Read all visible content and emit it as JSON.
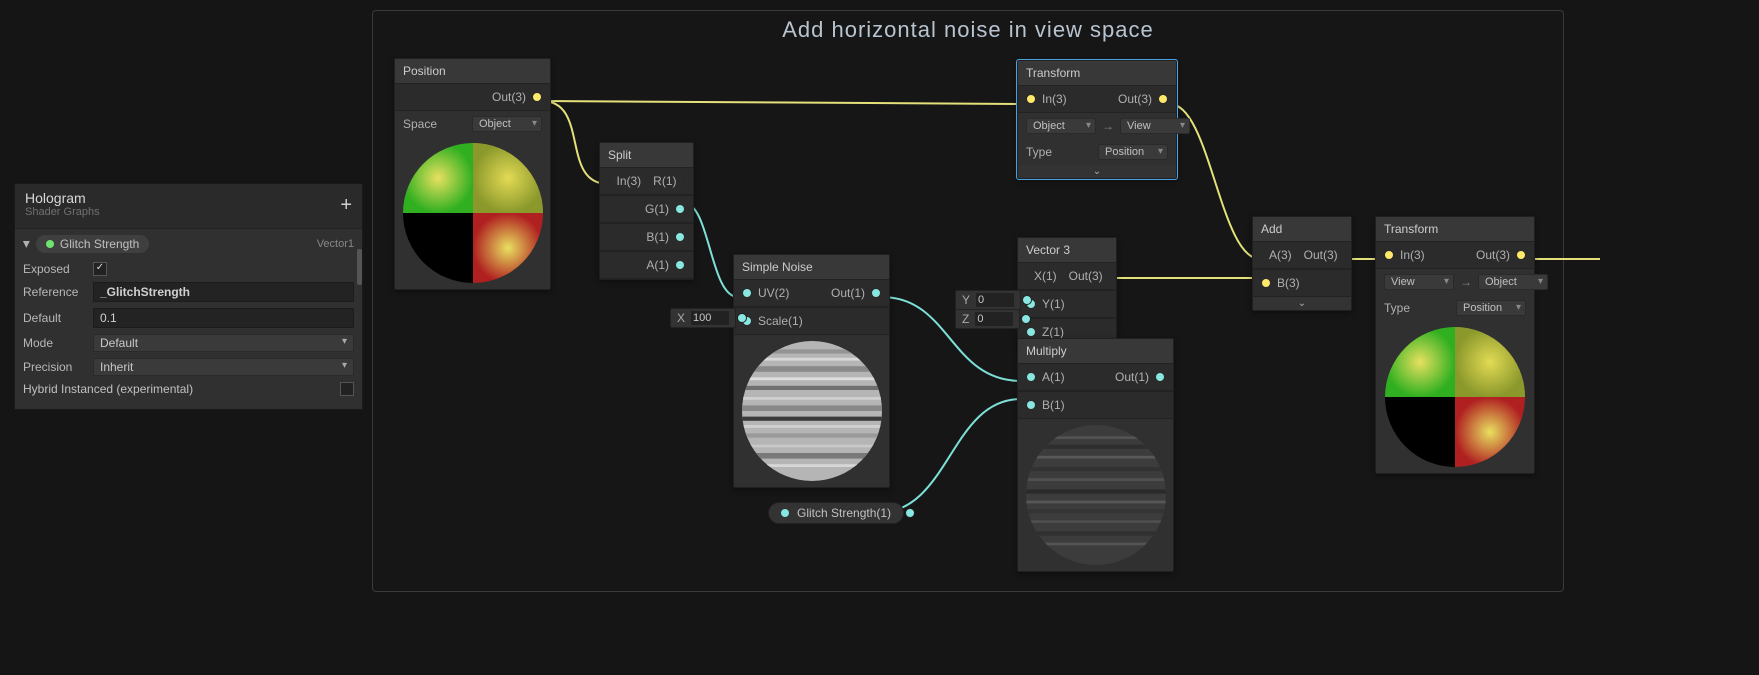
{
  "group_title": "Add horizontal noise in view space",
  "inspector": {
    "title": "Hologram",
    "subtitle": "Shader Graphs",
    "param_name": "Glitch Strength",
    "param_type": "Vector1",
    "exposed_label": "Exposed",
    "exposed_check": "✓",
    "reference_label": "Reference",
    "reference_value": "_GlitchStrength",
    "default_label": "Default",
    "default_value": "0.1",
    "mode_label": "Mode",
    "mode_value": "Default",
    "precision_label": "Precision",
    "precision_value": "Inherit",
    "hybrid_label": "Hybrid Instanced (experimental)"
  },
  "nodes": {
    "position": {
      "title": "Position",
      "out": "Out(3)",
      "space_label": "Space",
      "space_value": "Object"
    },
    "split": {
      "title": "Split",
      "in": "In(3)",
      "r": "R(1)",
      "g": "G(1)",
      "b": "B(1)",
      "a": "A(1)"
    },
    "simple_noise": {
      "title": "Simple Noise",
      "uv": "UV(2)",
      "scale": "Scale(1)",
      "out": "Out(1)",
      "x_label": "X",
      "x_value": "100"
    },
    "transform1": {
      "title": "Transform",
      "in": "In(3)",
      "out": "Out(3)",
      "from": "Object",
      "to": "View",
      "type_label": "Type",
      "type_value": "Position"
    },
    "vector3": {
      "title": "Vector 3",
      "x": "X(1)",
      "y": "Y(1)",
      "z": "Z(1)",
      "out": "Out(3)",
      "y_label": "Y",
      "y_value": "0",
      "z_label": "Z",
      "z_value": "0"
    },
    "multiply": {
      "title": "Multiply",
      "a": "A(1)",
      "b": "B(1)",
      "out": "Out(1)"
    },
    "add": {
      "title": "Add",
      "a": "A(3)",
      "b": "B(3)",
      "out": "Out(3)"
    },
    "transform2": {
      "title": "Transform",
      "in": "In(3)",
      "out": "Out(3)",
      "from": "View",
      "to": "Object",
      "type_label": "Type",
      "type_value": "Position"
    },
    "glitch_pill": "Glitch Strength(1)"
  }
}
